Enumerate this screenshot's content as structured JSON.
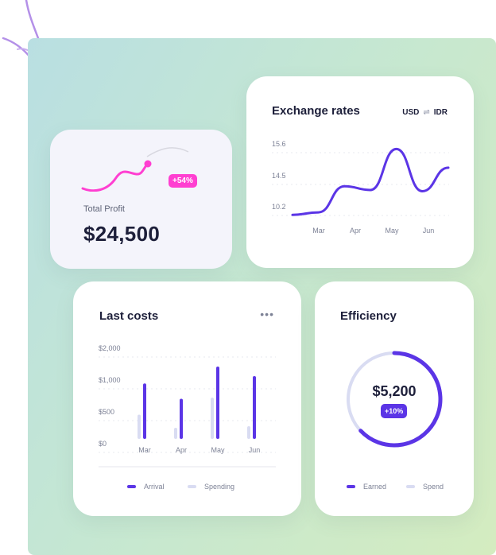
{
  "colors": {
    "accent": "#5b35e6",
    "accent_light": "#d9dcf2",
    "pink": "#ff3fd1",
    "text_dark": "#1d1f3a",
    "text_muted": "#7d8296"
  },
  "profit": {
    "label": "Total Profit",
    "value": "$24,500",
    "badge": "+54%"
  },
  "exchange": {
    "title": "Exchange rates",
    "from": "USD",
    "to": "IDR",
    "swap_symbol": "⇌"
  },
  "costs": {
    "title": "Last costs",
    "menu_icon": "more-horizontal-icon",
    "legend": [
      "Arrival",
      "Spending"
    ]
  },
  "efficiency": {
    "title": "Efficiency",
    "value": "$5,200",
    "badge": "+10%",
    "progress": 0.63,
    "legend": [
      "Earned",
      "Spend"
    ]
  },
  "chart_data": [
    {
      "type": "line",
      "title": "Exchange rates",
      "y_ticks": [
        "15.6",
        "14.5",
        "10.2"
      ],
      "x": [
        "Mar",
        "Apr",
        "May",
        "Jun"
      ],
      "series": [
        {
          "values": [
            10.1,
            10.3,
            12.4,
            12.1,
            15.4,
            12.0,
            13.9
          ]
        }
      ],
      "grid": true
    },
    {
      "type": "bar",
      "title": "Last costs",
      "categories": [
        "Mar",
        "Apr",
        "May",
        "Jun"
      ],
      "y_ticks": [
        "$2,000",
        "$1,000",
        "$500",
        "$0"
      ],
      "series": [
        {
          "name": "Arrival",
          "values": [
            1050,
            760,
            1370,
            1190
          ]
        },
        {
          "name": "Spending",
          "values": [
            460,
            210,
            780,
            240
          ]
        }
      ],
      "grid": true,
      "legend": "bottom"
    }
  ]
}
